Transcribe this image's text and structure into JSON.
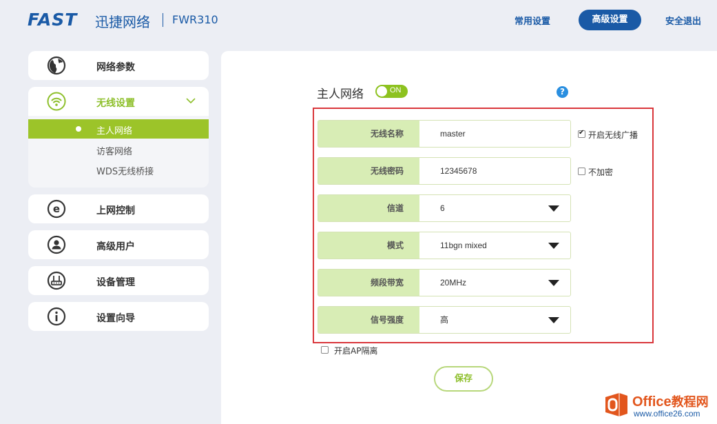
{
  "header": {
    "brand_fast": "FAST",
    "brand_cn": "迅捷网络",
    "model": "FWR310",
    "nav_common": "常用设置",
    "nav_advanced": "高级设置",
    "nav_logout": "安全退出",
    "brand_color": "#1a5aa6"
  },
  "sidebar": {
    "items": [
      {
        "label": "网络参数",
        "icon": "globe-icon"
      },
      {
        "label": "无线设置",
        "icon": "wifi-icon"
      },
      {
        "label": "上网控制",
        "icon": "e-icon"
      },
      {
        "label": "高级用户",
        "icon": "user-icon"
      },
      {
        "label": "设备管理",
        "icon": "router-icon"
      },
      {
        "label": "设置向导",
        "icon": "info-icon"
      }
    ],
    "wireless_sub": [
      {
        "label": "主人网络",
        "active": true
      },
      {
        "label": "访客网络",
        "active": false
      },
      {
        "label": "WDS无线桥接",
        "active": false
      }
    ],
    "accent_color": "#9cc429"
  },
  "main": {
    "title": "主人网络",
    "toggle_label": "ON",
    "help": "?",
    "rows": [
      {
        "label": "无线名称",
        "value": "master",
        "type": "text"
      },
      {
        "label": "无线密码",
        "value": "12345678",
        "type": "text"
      },
      {
        "label": "信道",
        "value": "6",
        "type": "select"
      },
      {
        "label": "模式",
        "value": "11bgn mixed",
        "type": "select"
      },
      {
        "label": "频段带宽",
        "value": "20MHz",
        "type": "select"
      },
      {
        "label": "信号强度",
        "value": "高",
        "type": "select"
      }
    ],
    "broadcast_label": "开启无线广播",
    "broadcast_checked": true,
    "no_encrypt_label": "不加密",
    "no_encrypt_checked": false,
    "ap_isolation_label": "开启AP隔离",
    "ap_isolation_checked": false,
    "save_label": "保存"
  },
  "watermark": {
    "name": "Office",
    "name_cn": "教程网",
    "url": "www.office26.com"
  }
}
